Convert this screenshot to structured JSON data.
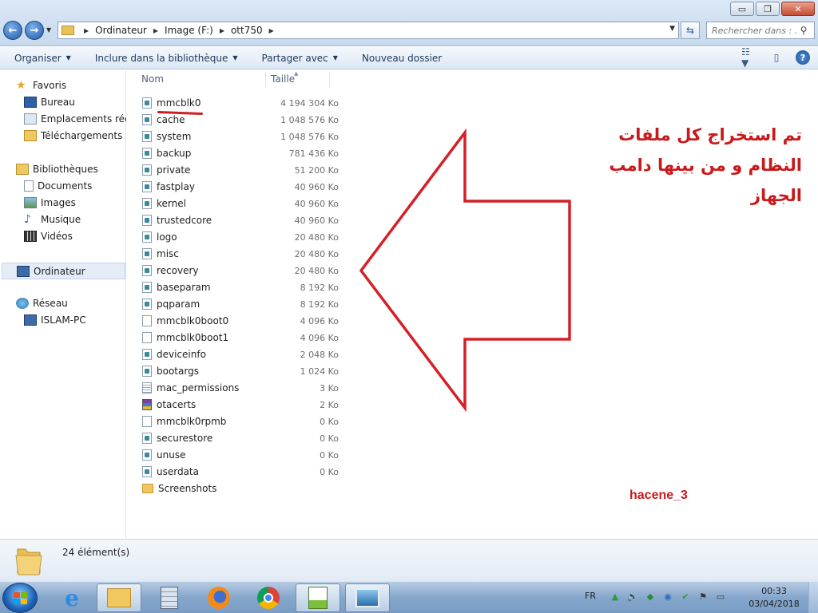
{
  "window": {
    "minimize_label": "▭",
    "maximize_label": "❐",
    "close_label": "✕"
  },
  "address": {
    "crumbs": [
      "Ordinateur",
      "Image (F:)",
      "ott750"
    ]
  },
  "search": {
    "placeholder": "Rechercher dans : ..."
  },
  "toolbar": {
    "organize": "Organiser",
    "include": "Inclure dans la bibliothèque",
    "share": "Partager avec",
    "new_folder": "Nouveau dossier"
  },
  "sidebar": {
    "favorites": "Favoris",
    "desktop": "Bureau",
    "recent": "Emplacements récents",
    "downloads": "Téléchargements",
    "libraries": "Bibliothèques",
    "documents": "Documents",
    "images": "Images",
    "music": "Musique",
    "videos": "Vidéos",
    "computer": "Ordinateur",
    "network": "Réseau",
    "pc": "ISLAM-PC"
  },
  "columns": {
    "name": "Nom",
    "size": "Taille"
  },
  "files": [
    {
      "name": "mmcblk0",
      "size": "4 194 304 Ko",
      "icon": "sys"
    },
    {
      "name": "cache",
      "size": "1 048 576 Ko",
      "icon": "sys"
    },
    {
      "name": "system",
      "size": "1 048 576 Ko",
      "icon": "sys"
    },
    {
      "name": "backup",
      "size": "781 436 Ko",
      "icon": "sys"
    },
    {
      "name": "private",
      "size": "51 200 Ko",
      "icon": "sys"
    },
    {
      "name": "fastplay",
      "size": "40 960 Ko",
      "icon": "sys"
    },
    {
      "name": "kernel",
      "size": "40 960 Ko",
      "icon": "sys"
    },
    {
      "name": "trustedcore",
      "size": "40 960 Ko",
      "icon": "sys"
    },
    {
      "name": "logo",
      "size": "20 480 Ko",
      "icon": "sys"
    },
    {
      "name": "misc",
      "size": "20 480 Ko",
      "icon": "sys"
    },
    {
      "name": "recovery",
      "size": "20 480 Ko",
      "icon": "sys"
    },
    {
      "name": "baseparam",
      "size": "8 192 Ko",
      "icon": "sys"
    },
    {
      "name": "pqparam",
      "size": "8 192 Ko",
      "icon": "sys"
    },
    {
      "name": "mmcblk0boot0",
      "size": "4 096 Ko",
      "icon": "blank"
    },
    {
      "name": "mmcblk0boot1",
      "size": "4 096 Ko",
      "icon": "blank"
    },
    {
      "name": "deviceinfo",
      "size": "2 048 Ko",
      "icon": "sys"
    },
    {
      "name": "bootargs",
      "size": "1 024 Ko",
      "icon": "sys"
    },
    {
      "name": "mac_permissions",
      "size": "3 Ko",
      "icon": "cfg"
    },
    {
      "name": "otacerts",
      "size": "2 Ko",
      "icon": "rar"
    },
    {
      "name": "mmcblk0rpmb",
      "size": "0 Ko",
      "icon": "blank"
    },
    {
      "name": "securestore",
      "size": "0 Ko",
      "icon": "sys"
    },
    {
      "name": "unuse",
      "size": "0 Ko",
      "icon": "sys"
    },
    {
      "name": "userdata",
      "size": "0 Ko",
      "icon": "sys"
    },
    {
      "name": "Screenshots",
      "size": "",
      "icon": "folder"
    }
  ],
  "annotation": {
    "arabic_line1": "تم استخراج كل ملفات",
    "arabic_line2": "النظام و من بينها دامب",
    "arabic_line3": "الجهاز",
    "signature": "hacene_3",
    "color": "#c8191b"
  },
  "details": {
    "count": "24 élément(s)"
  },
  "taskbar": {
    "lang": "FR",
    "time": "00:33",
    "date": "03/04/2018"
  }
}
